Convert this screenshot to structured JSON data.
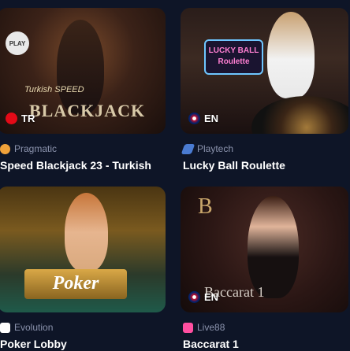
{
  "games": [
    {
      "title": "Speed Blackjack 23 - Turkish",
      "provider": "Pragmatic",
      "lang": "TR",
      "provider_color": "#f0a23a"
    },
    {
      "title": "Lucky Ball Roulette",
      "provider": "Playtech",
      "lang": "EN",
      "provider_color": "#4a7bd1"
    },
    {
      "title": "Poker Lobby",
      "provider": "Evolution",
      "lang": "",
      "provider_color": "#ffffff"
    },
    {
      "title": "Baccarat 1",
      "provider": "Live88",
      "lang": "EN",
      "provider_color": "#ff4fa0"
    }
  ],
  "art": {
    "bj_main": "BLACKJACK",
    "bj_sub": "Turkish SPEED",
    "play_logo": "PLAY",
    "lucky_sign": "LUCKY BALL Roulette",
    "poker_sign": "Poker",
    "bac_b": "B",
    "bac_text": "Baccarat 1"
  }
}
